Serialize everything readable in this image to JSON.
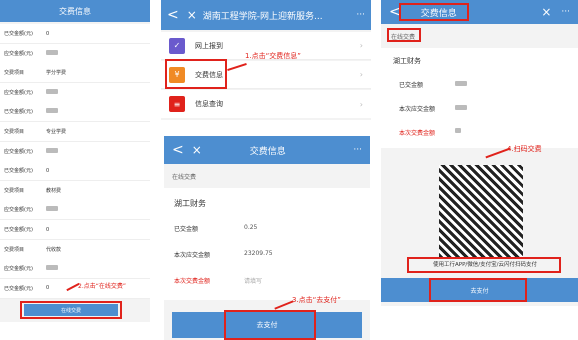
{
  "p1": {
    "title": "交费信息",
    "rows": [
      {
        "l": "已交金额(元)",
        "v": "0"
      },
      {
        "l": "应交金额(元)",
        "v": ""
      },
      {
        "l": "交费项目",
        "v": "学分学费"
      },
      {
        "l": "应交金额(元)",
        "v": ""
      },
      {
        "l": "已交金额(元)",
        "v": ""
      },
      {
        "l": "交费项目",
        "v": "专业学费"
      },
      {
        "l": "应交金额(元)",
        "v": ""
      },
      {
        "l": "已交金额(元)",
        "v": "0"
      },
      {
        "l": "交费项目",
        "v": "教材费"
      },
      {
        "l": "应交金额(元)",
        "v": ""
      },
      {
        "l": "已交金额(元)",
        "v": "0"
      },
      {
        "l": "交费项目",
        "v": "代收款"
      },
      {
        "l": "应交金额(元)",
        "v": ""
      },
      {
        "l": "已交金额(元)",
        "v": "0"
      }
    ],
    "annotation": "2.点击“在线交费”",
    "button": "在线交费"
  },
  "p2": {
    "back": "<",
    "close": "×",
    "title": "湖南工程学院-网上迎新服务...",
    "more": "···",
    "menu": [
      {
        "label": "网上报到",
        "color": "#6a5acd"
      },
      {
        "label": "交费信息",
        "color": "#f08a24"
      },
      {
        "label": "信息查询",
        "color": "#e0221b"
      }
    ],
    "annotation1": "1.点击“交费信息”",
    "title2": "交费信息",
    "section": "在线交费",
    "org": "湖工财务",
    "paid_label": "已交金额",
    "paid_value": "0.25",
    "due_label": "本次应交金额",
    "due_value": "23209.75",
    "pay_label": "本次交费金额",
    "pay_placeholder": "请填写",
    "annotation3": "3.点击“去支付”",
    "button": "去支付"
  },
  "p3": {
    "title": "交费信息",
    "section": "在线交费",
    "org": "湖工财务",
    "paid_label": "已交金额",
    "due_label": "本次应交金额",
    "pay_label": "本次交费金额",
    "annotation4": "4.扫码交费",
    "qr_note": "使用工行APP/微信/支付宝/云闪付扫码支付",
    "button": "去支付"
  }
}
